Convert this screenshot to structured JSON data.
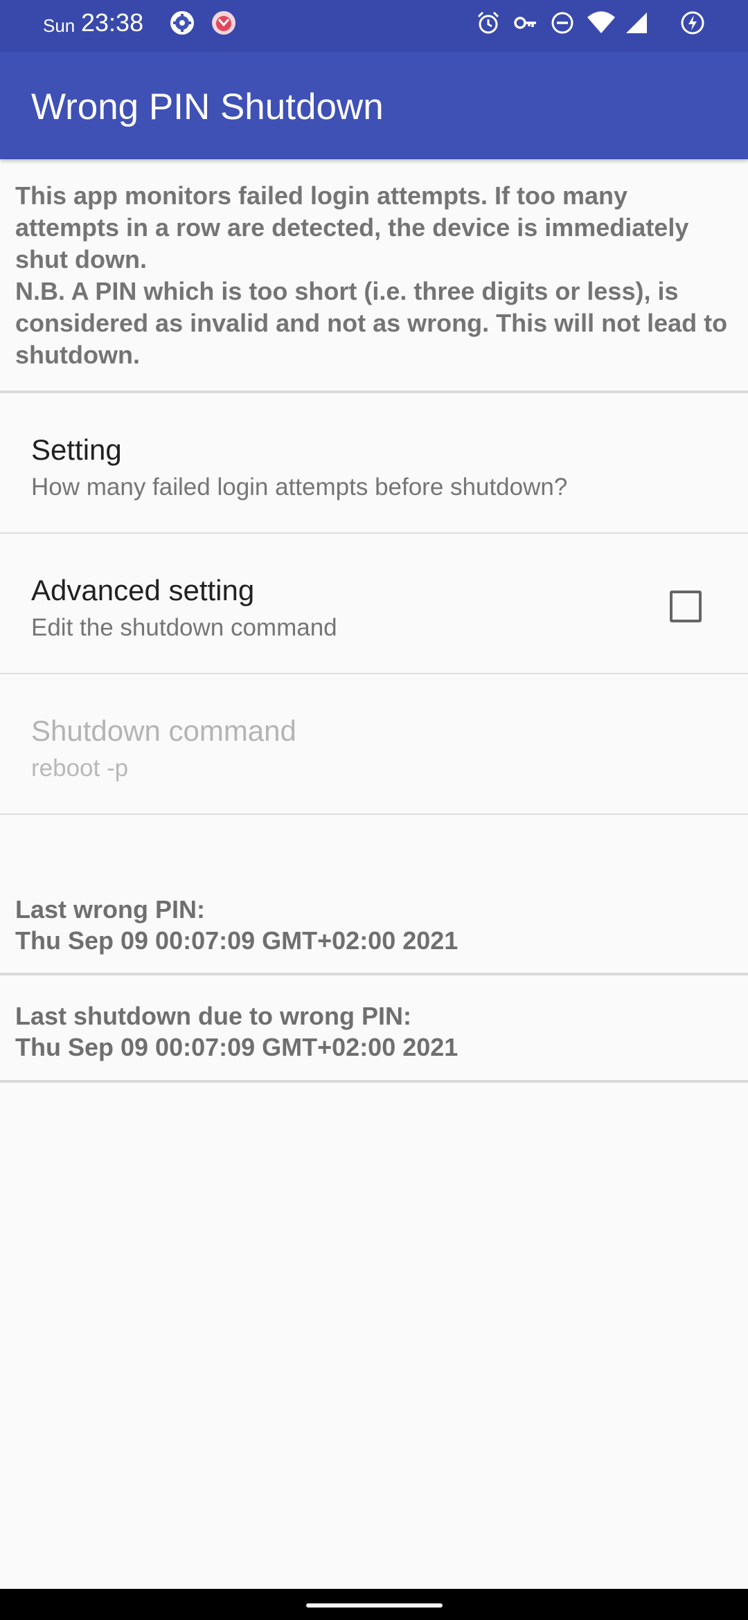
{
  "status_bar": {
    "day": "Sun",
    "time": "23:38",
    "left_icons": [
      "settings-gear-icon",
      "app-notification-icon"
    ],
    "right_icons": [
      "alarm-icon",
      "vpn-key-icon",
      "do-not-disturb-icon",
      "wifi-icon",
      "cellular-signal-icon",
      "battery-saver-icon"
    ],
    "background_color": "#3949ab"
  },
  "app_bar": {
    "title": "Wrong PIN Shutdown",
    "color": "#3f51b5"
  },
  "intro": {
    "line1": "This app monitors failed login attempts. If too many attempts in a row are detected, the device is immediately shut down.",
    "line2": "N.B. A PIN which is too short (i.e. three digits or less), is considered as invalid and not as wrong. This will not lead to shutdown."
  },
  "preferences": [
    {
      "title": "Setting",
      "summary": "How many failed login attempts before shutdown?"
    },
    {
      "title": "Advanced setting",
      "summary": "Edit the shutdown command",
      "checked": false
    },
    {
      "title": "Shutdown command",
      "summary": "reboot -p",
      "enabled": false
    }
  ],
  "last_wrong_pin": {
    "label": "Last wrong PIN:",
    "value": "Thu Sep 09 00:07:09 GMT+02:00 2021"
  },
  "last_shutdown": {
    "label": "Last shutdown due to wrong PIN:",
    "value": "Thu Sep 09 00:07:09 GMT+02:00 2021"
  }
}
